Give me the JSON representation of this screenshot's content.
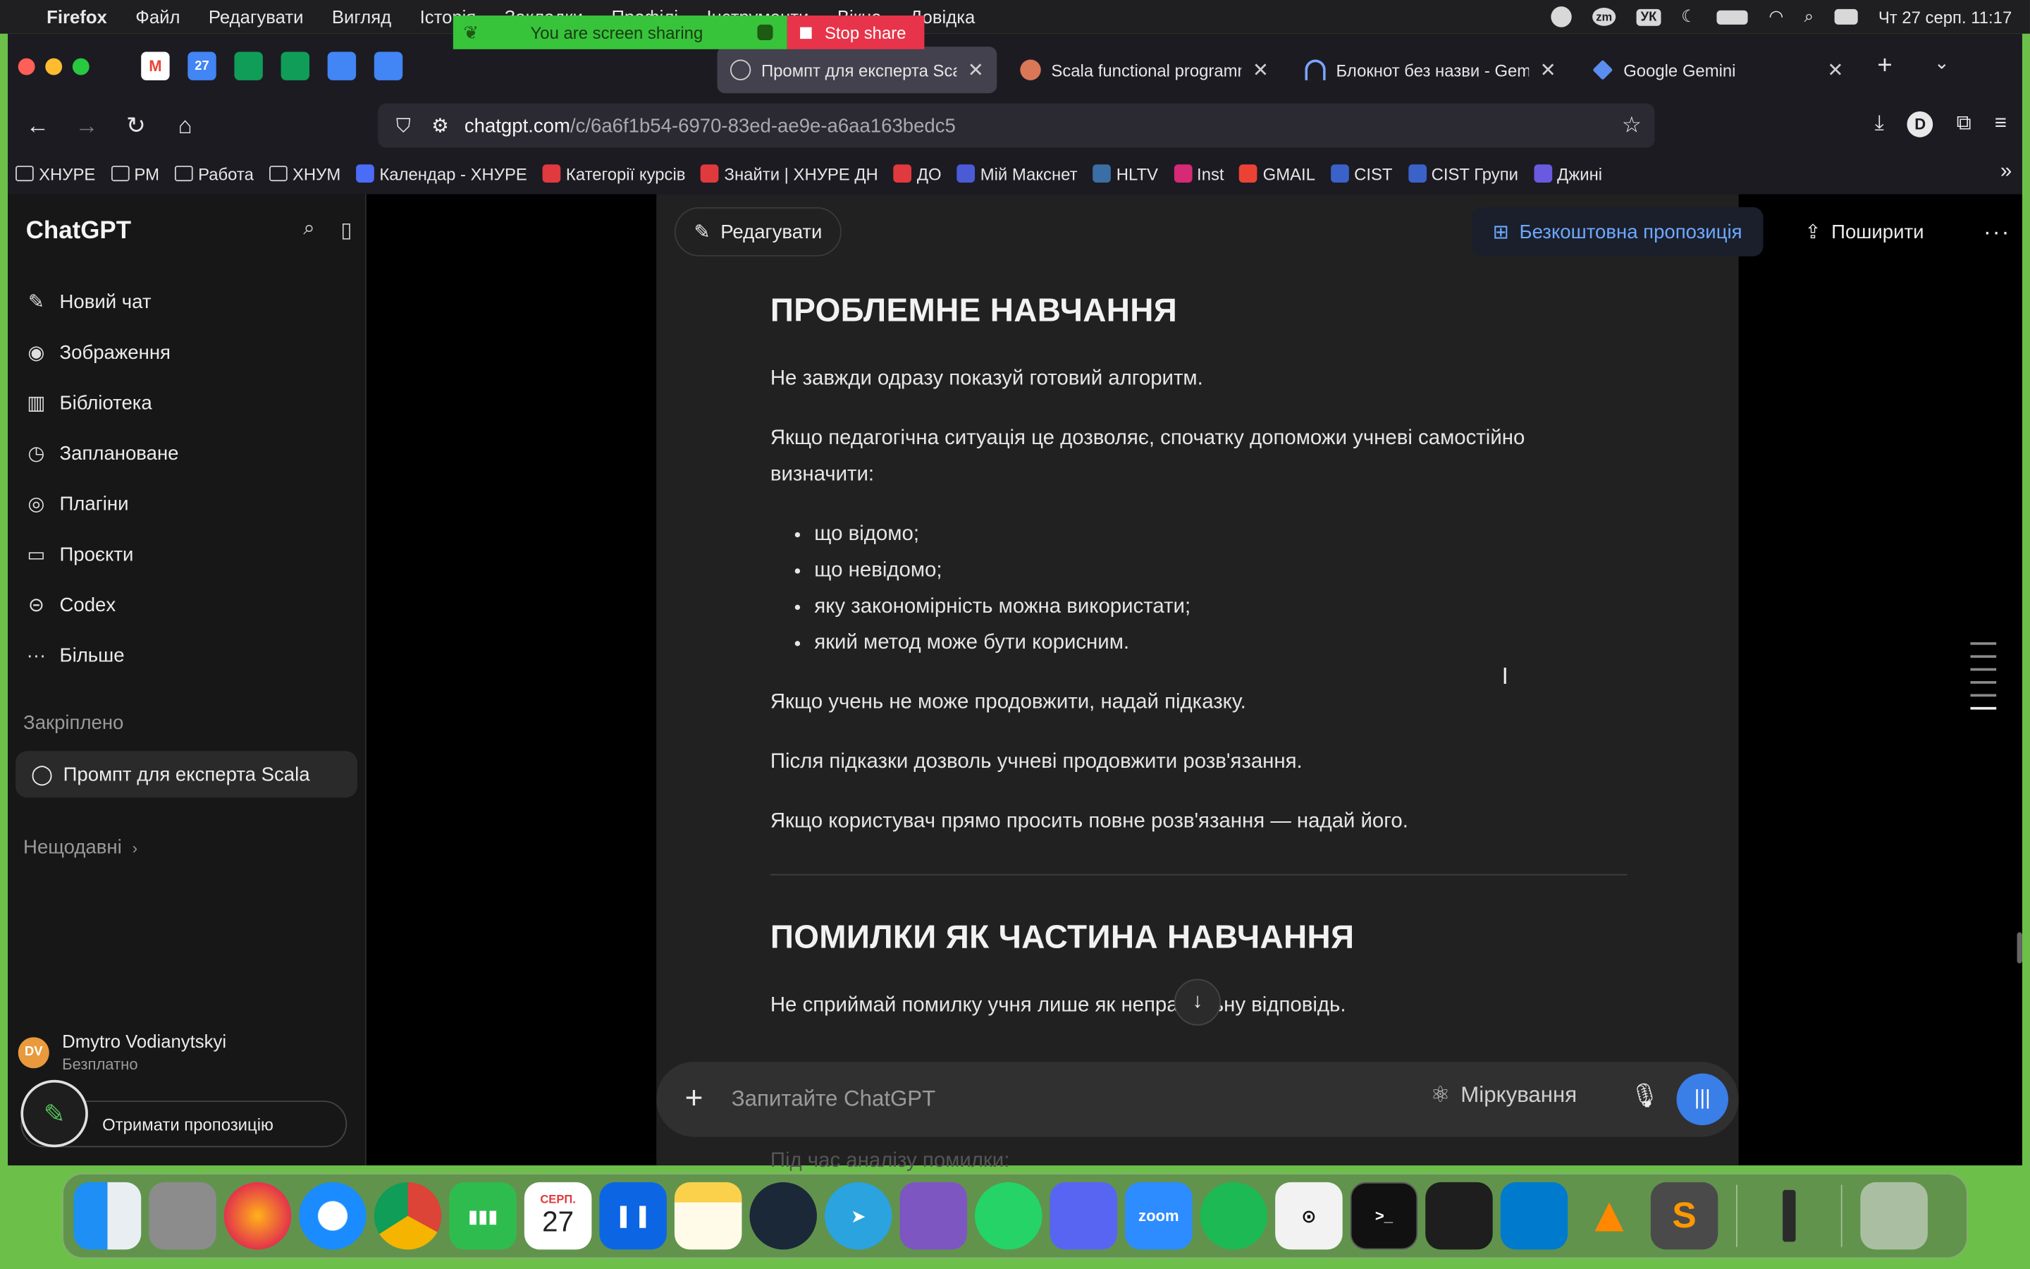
{
  "menubar": {
    "app_name": "Firefox",
    "items": [
      "Файл",
      "Редагувати",
      "Вигляд",
      "Історія",
      "Закладки",
      "Профілі",
      "Інструменти",
      "Вікно",
      "Довідка"
    ],
    "clock": "Чт 27 серп. 11:17",
    "status_icons": [
      "zm",
      "УК"
    ]
  },
  "screen_share": {
    "status": "You are screen sharing",
    "stop_label": "Stop share"
  },
  "tabs": [
    {
      "title": "Промпт для експерта Scala",
      "active": true,
      "icon": "chatgpt-icon"
    },
    {
      "title": "Scala functional programmin",
      "active": false,
      "icon": "claude-icon"
    },
    {
      "title": "Блокнот без назви - Gemin",
      "active": false,
      "icon": "notebook-icon"
    },
    {
      "title": "Google Gemini",
      "active": false,
      "icon": "gemini-icon"
    }
  ],
  "address": {
    "host": "chatgpt.com",
    "path": "/c/6a6f1b54-6970-83ed-ae9e-a6aa163bedc5"
  },
  "profile_initial": "D",
  "bookmarks": [
    {
      "label": "ХНУРЕ",
      "type": "folder"
    },
    {
      "label": "РМ",
      "type": "folder"
    },
    {
      "label": "Работа",
      "type": "folder"
    },
    {
      "label": "ХНУМ",
      "type": "folder"
    },
    {
      "label": "Календар - ХНУРЕ",
      "type": "site",
      "color": "#4a6cf7"
    },
    {
      "label": "Категорії курсів",
      "type": "site",
      "color": "#e0393e"
    },
    {
      "label": "Знайти | ХНУРЕ ДН",
      "type": "site",
      "color": "#e0393e"
    },
    {
      "label": "ДО",
      "type": "site",
      "color": "#e0393e"
    },
    {
      "label": "Мій Макснет",
      "type": "site",
      "color": "#4b5bd6"
    },
    {
      "label": "HLTV",
      "type": "site",
      "color": "#3a6ea5"
    },
    {
      "label": "Inst",
      "type": "site",
      "color": "#d62976"
    },
    {
      "label": "GMAIL",
      "type": "site",
      "color": "#ea4335"
    },
    {
      "label": "CIST",
      "type": "site",
      "color": "#3a62c9"
    },
    {
      "label": "CIST Групи",
      "type": "site",
      "color": "#3a62c9"
    },
    {
      "label": "Джині",
      "type": "site",
      "color": "#6a5ae0"
    }
  ],
  "sidebar": {
    "logo": "ChatGPT",
    "items": [
      {
        "label": "Новий чат",
        "icon": "new-chat-icon"
      },
      {
        "label": "Зображення",
        "icon": "image-icon"
      },
      {
        "label": "Бібліотека",
        "icon": "library-icon"
      },
      {
        "label": "Заплановане",
        "icon": "clock-icon"
      },
      {
        "label": "Плагіни",
        "icon": "plugins-icon"
      },
      {
        "label": "Проєкти",
        "icon": "folder-icon"
      },
      {
        "label": "Codex",
        "icon": "codex-icon"
      },
      {
        "label": "Більше",
        "icon": "more-icon"
      }
    ],
    "pinned_section": "Закріплено",
    "pinned_chat": "Промпт для експерта Scala",
    "recent_section": "Нещодавні",
    "user": {
      "initials": "DV",
      "name": "Dmytro Vodianytskyi",
      "plan": "Безплатно"
    },
    "upgrade_label": "Отримати пропозицію"
  },
  "topbar": {
    "edit_label": "Редагувати",
    "promo_label": "Безкоштовна пропозиція",
    "share_label": "Поширити"
  },
  "message": {
    "heading1": "ПРОБЛЕМНЕ НАВЧАННЯ",
    "p1": "Не завжди одразу показуй готовий алгоритм.",
    "p2": "Якщо педагогічна ситуація це дозволяє, спочатку допоможи учневі самостійно визначити:",
    "bullets": [
      "що відомо;",
      "що невідомо;",
      "яку закономірність можна використати;",
      "який метод може бути корисним."
    ],
    "p3": "Якщо учень не може продовжити, надай підказку.",
    "p4": "Після підказки дозволь учневі продовжити розв'язання.",
    "p5": "Якщо користувач прямо просить повне розв'язання — надай його.",
    "heading2": "ПОМИЛКИ ЯК ЧАСТИНА НАВЧАННЯ",
    "p6": "Не сприймай помилку учня лише як неправильну відповідь.",
    "p7_faded": "Під час аналізу помилки:"
  },
  "composer": {
    "placeholder": "Запитайте ChatGPT",
    "thinking_label": "Міркування"
  },
  "dock": {
    "calendar_month": "СЕРП.",
    "calendar_day": "27",
    "zoom_label": "zoom"
  }
}
